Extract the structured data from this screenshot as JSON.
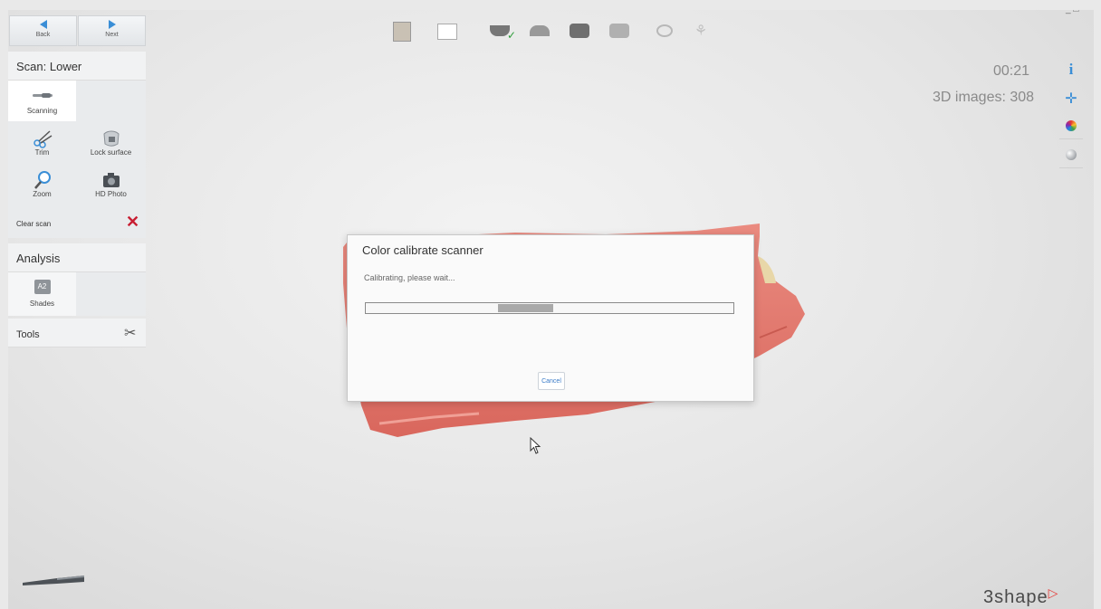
{
  "nav": {
    "back_label": "Back",
    "next_label": "Next"
  },
  "scan_panel": {
    "title": "Scan: Lower",
    "scanning_label": "Scanning",
    "trim_label": "Trim",
    "lock_surface_label": "Lock surface",
    "zoom_label": "Zoom",
    "hd_photo_label": "HD Photo",
    "clear_scan_label": "Clear scan"
  },
  "analysis_panel": {
    "title": "Analysis",
    "shades_label": "Shades",
    "shade_badge": "A2"
  },
  "tools_panel": {
    "title": "Tools"
  },
  "status": {
    "timer": "00:21",
    "images_label": "3D images: 308"
  },
  "right_icons": [
    "info-icon",
    "move-icon",
    "color-wheel-icon",
    "texture-ball-icon"
  ],
  "workflow_steps": [
    "patient-icon",
    "order-icon",
    "scan-lower-icon",
    "scan-upper-icon",
    "bite-icon",
    "scan-bite-icon",
    "analysis-icon",
    "send-icon"
  ],
  "dialog": {
    "title": "Color calibrate scanner",
    "message": "Calibrating, please wait...",
    "progress_fraction": 0.15,
    "cancel_label": "Cancel"
  },
  "brand": {
    "logo_text": "3shape",
    "accent": "#e53935"
  },
  "colors": {
    "accent_blue": "#3a8ed6",
    "clear_red": "#c81e32",
    "gum_pink": "#e07a70"
  }
}
